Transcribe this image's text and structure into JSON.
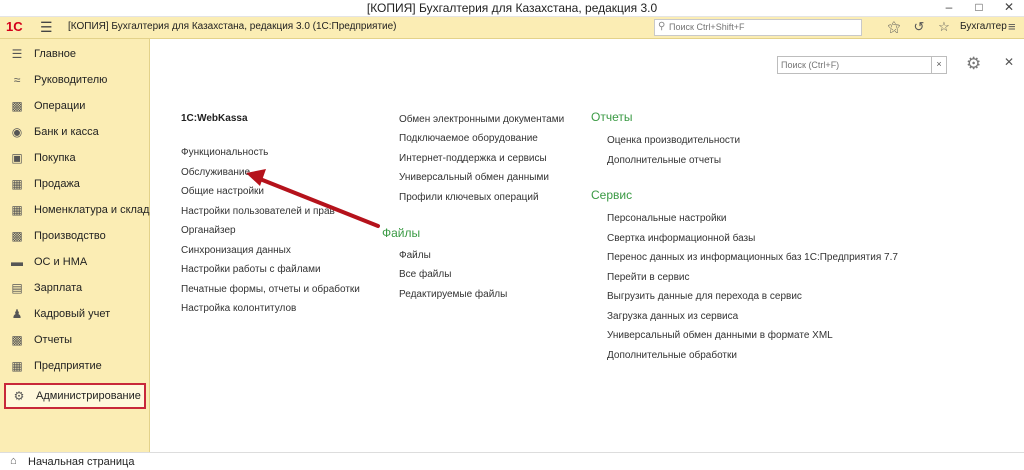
{
  "window": {
    "title": "[КОПИЯ] Бухгалтерия для Казахстана, редакция 3.0"
  },
  "appbar": {
    "logo": "1С",
    "title": "[КОПИЯ] Бухгалтерия для Казахстана, редакция 3.0  (1С:Предприятие)",
    "search_placeholder": "Поиск Ctrl+Shift+F",
    "user": "Бухгалтер"
  },
  "sidebar": {
    "items": [
      {
        "label": "Главное",
        "icon": "menu-icon"
      },
      {
        "label": "Руководителю",
        "icon": "chart-line-icon"
      },
      {
        "label": "Операции",
        "icon": "operations-icon"
      },
      {
        "label": "Банк и касса",
        "icon": "coin-icon"
      },
      {
        "label": "Покупка",
        "icon": "cart-icon"
      },
      {
        "label": "Продажа",
        "icon": "bag-icon"
      },
      {
        "label": "Номенклатура и склад",
        "icon": "warehouse-icon"
      },
      {
        "label": "Производство",
        "icon": "factory-icon"
      },
      {
        "label": "ОС и НМА",
        "icon": "truck-icon"
      },
      {
        "label": "Зарплата",
        "icon": "salary-icon"
      },
      {
        "label": "Кадровый учет",
        "icon": "people-icon"
      },
      {
        "label": "Отчеты",
        "icon": "report-icon"
      },
      {
        "label": "Предприятие",
        "icon": "building-icon"
      },
      {
        "label": "Администрирование",
        "icon": "gear-icon"
      }
    ],
    "active_index": 13
  },
  "footer": {
    "start_page": "Начальная страница"
  },
  "main": {
    "search_placeholder": "Поиск (Ctrl+F)",
    "clear": "×",
    "column1": {
      "heading": "1C:WebKassa",
      "links": [
        "Функциональность",
        "Обслуживание",
        "Общие настройки",
        "Настройки пользователей и прав",
        "Органайзер",
        "Синхронизация данных",
        "Настройки работы с файлами",
        "Печатные формы, отчеты и обработки",
        "Настройка колонтитулов"
      ]
    },
    "column2": {
      "links_top": [
        "Обмен электронными документами",
        "Подключаемое оборудование",
        "Интернет-поддержка и сервисы",
        "Универсальный обмен данными",
        "Профили ключевых операций"
      ],
      "section_files": "Файлы",
      "files_links": [
        "Файлы",
        "Все файлы",
        "Редактируемые файлы"
      ]
    },
    "column3": {
      "section_reports": "Отчеты",
      "reports_links": [
        "Оценка производительности",
        "Дополнительные отчеты"
      ],
      "section_service": "Сервис",
      "service_links": [
        "Персональные настройки",
        "Свертка информационной базы",
        "Перенос данных из информационных баз 1С:Предприятия 7.7",
        "Перейти в сервис",
        "Выгрузить данные для перехода в сервис",
        "Загрузка данных из сервиса",
        "Универсальный обмен данными в формате XML",
        "Дополнительные обработки"
      ]
    }
  },
  "colors": {
    "panel": "#fbedb4",
    "section_green": "#3a9a44",
    "highlight_red": "#c8283a",
    "arrow_red": "#b5121b"
  }
}
